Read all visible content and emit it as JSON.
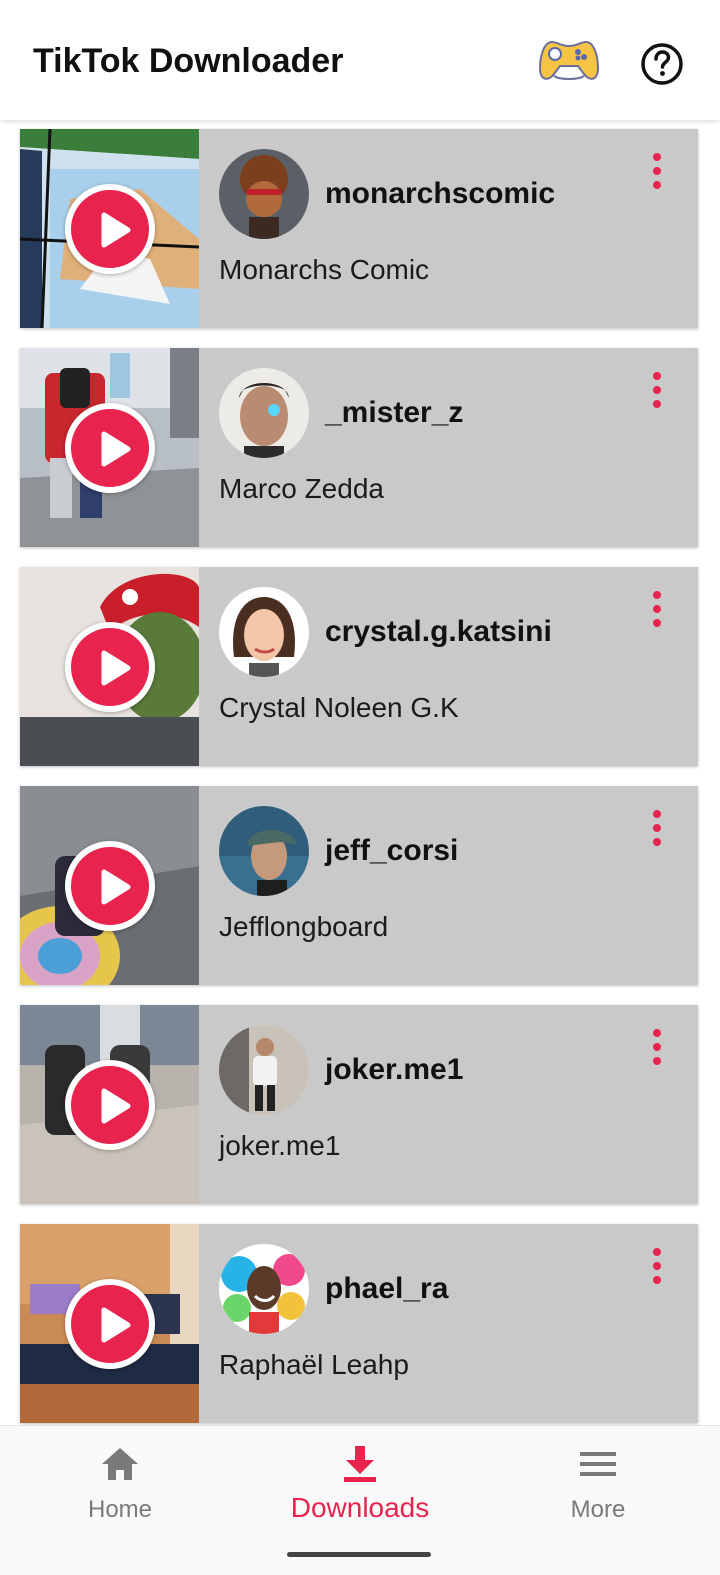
{
  "app": {
    "title": "TikTok Downloader",
    "accent": "#e8234e"
  },
  "header": {
    "game_icon": "gamepad-icon",
    "help_icon": "help-icon"
  },
  "downloads": [
    {
      "username": "monarchscomic",
      "display_name": "Monarchs Comic"
    },
    {
      "username": "_mister_z",
      "display_name": "Marco Zedda"
    },
    {
      "username": "crystal.g.katsini",
      "display_name": "Crystal Noleen G.K"
    },
    {
      "username": "jeff_corsi",
      "display_name": "Jefflongboard"
    },
    {
      "username": "joker.me1",
      "display_name": "joker.me1"
    },
    {
      "username": "phael_ra",
      "display_name": "Raphaël Leahp"
    }
  ],
  "bottom_nav": {
    "items": [
      {
        "label": "Home",
        "icon": "home-icon",
        "active": false
      },
      {
        "label": "Downloads",
        "icon": "download-icon",
        "active": true
      },
      {
        "label": "More",
        "icon": "menu-icon",
        "active": false
      }
    ]
  }
}
